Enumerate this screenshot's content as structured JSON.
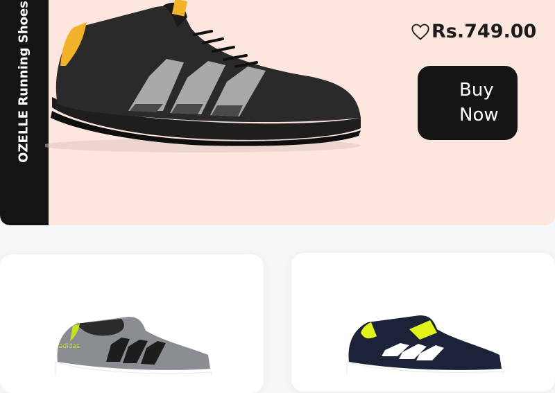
{
  "hero": {
    "title": "OZELLE Running Shoes",
    "price": "Rs.749.00",
    "buy_label_line1": "Buy",
    "buy_label_line2": "Now",
    "colors": {
      "band": "#141414",
      "background": "#fde6de",
      "button": "#151515"
    }
  },
  "products": [
    {
      "image": "grey-running-shoe-image",
      "colorway": "grey / black / lime"
    },
    {
      "image": "navy-running-shoe-image",
      "colorway": "navy / yellow / white"
    }
  ],
  "icons": {
    "wishlist": "heart-icon"
  }
}
